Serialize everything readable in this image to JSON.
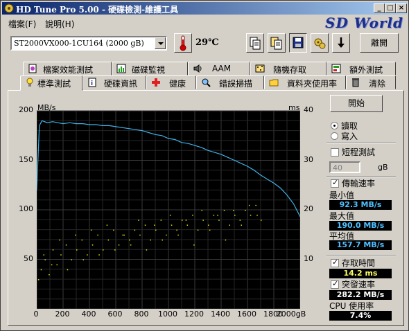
{
  "title": "HD Tune Pro  5.00 - 硬碟檢測-維護工具",
  "window_buttons": {
    "minimize": "_",
    "maximize": "□",
    "close": "×"
  },
  "menu": [
    {
      "label": "檔案(F)"
    },
    {
      "label": "說明(H)"
    }
  ],
  "brand": "SD World",
  "drive": {
    "selected": "ST2000VX000-1CU164        (2000 gB)"
  },
  "temperature": "29℃",
  "toolbar_icons": [
    "copy-icon",
    "copy-screen-icon",
    "save-icon",
    "options-icon",
    "download-icon"
  ],
  "exit_label": "離開",
  "tabs_row1": [
    {
      "label": "檔案效能測試",
      "icon": "file-benchmark-icon"
    },
    {
      "label": "磁碟監視",
      "icon": "disk-monitor-icon"
    },
    {
      "label": "AAM",
      "icon": "speaker-icon"
    },
    {
      "label": "隨機存取",
      "icon": "random-access-icon"
    },
    {
      "label": "額外測試",
      "icon": "extra-tests-icon"
    }
  ],
  "tabs_row2": [
    {
      "label": "標準測試",
      "icon": "bulb-icon",
      "active": true
    },
    {
      "label": "硬碟資訊",
      "icon": "info-icon"
    },
    {
      "label": "健康",
      "icon": "health-cross-icon"
    },
    {
      "label": "錯誤掃描",
      "icon": "magnifier-icon"
    },
    {
      "label": "資料夾使用率",
      "icon": "folder-icon"
    },
    {
      "label": "清除",
      "icon": "trash-icon"
    }
  ],
  "controls": {
    "start_label": "開始",
    "read_label": "讀取",
    "write_label": "寫入",
    "short_test_label": "短程測試",
    "short_test_value": "40",
    "short_test_unit": "gB",
    "transfer_rate_label": "傳輸速率",
    "min_label": "最小值",
    "min_value": "92.3 MB/s",
    "max_label": "最大值",
    "max_value": "190.0 MB/s",
    "avg_label": "平均值",
    "avg_value": "157.7 MB/s",
    "access_time_label": "存取時間",
    "access_time_value": "14.2 ms",
    "burst_rate_label": "突發速率",
    "burst_rate_value": "282.2 MB/s",
    "cpu_label": "CPU 使用率",
    "cpu_value": "7.4%"
  },
  "colors": {
    "transfer_line": "#3fb2e8",
    "access_points": "#e8e000",
    "chart_bg": "#000000",
    "titlebar": "#0a246a"
  },
  "chart_data": {
    "type": "line",
    "x_unit": "gB",
    "y_left_unit": "MB/s",
    "y_right_unit": "ms",
    "x_ticks": [
      "0",
      "200",
      "400",
      "600",
      "800",
      "1000",
      "1200",
      "1400",
      "1600",
      "1800",
      "2000gB"
    ],
    "y_left_ticks": [
      "50",
      "100",
      "150",
      "200"
    ],
    "y_right_ticks": [
      "10",
      "20",
      "30",
      "40"
    ],
    "xlim": [
      0,
      2000
    ],
    "ylim_left": [
      0,
      200
    ],
    "ylim_right": [
      0,
      40
    ],
    "grid": true,
    "series": [
      {
        "name": "傳輸速率",
        "axis": "left",
        "x": [
          0,
          20,
          40,
          80,
          120,
          160,
          200,
          250,
          300,
          350,
          400,
          450,
          500,
          550,
          600,
          650,
          700,
          750,
          800,
          850,
          900,
          950,
          1000,
          1050,
          1100,
          1150,
          1200,
          1250,
          1300,
          1350,
          1400,
          1450,
          1500,
          1550,
          1600,
          1650,
          1700,
          1750,
          1800,
          1850,
          1900,
          1950,
          2000
        ],
        "values": [
          120,
          185,
          190,
          188,
          189,
          188,
          187,
          188,
          187,
          187,
          186,
          186,
          185,
          185,
          184,
          183,
          182,
          181,
          180,
          178,
          176,
          175,
          172,
          171,
          168,
          167,
          165,
          163,
          160,
          158,
          156,
          153,
          150,
          147,
          144,
          140,
          135,
          131,
          127,
          122,
          115,
          106,
          93
        ]
      },
      {
        "name": "存取時間",
        "axis": "right",
        "type": "scatter",
        "x": [
          10,
          30,
          60,
          90,
          120,
          150,
          180,
          220,
          260,
          300,
          340,
          380,
          420,
          460,
          500,
          540,
          580,
          620,
          660,
          700,
          740,
          780,
          820,
          860,
          900,
          940,
          980,
          1020,
          1060,
          1100,
          1140,
          1180,
          1220,
          1260,
          1300,
          1340,
          1380,
          1420,
          1460,
          1500,
          1540,
          1580,
          1620,
          1660,
          1700,
          50,
          110,
          170,
          230,
          290,
          350,
          410,
          470,
          530,
          590,
          650,
          710,
          770,
          830,
          890,
          950,
          1010,
          1070,
          1130,
          1190,
          1250,
          1310,
          1370,
          1430,
          1490,
          1550,
          1610,
          1670
        ],
        "values": [
          6,
          8,
          10,
          7,
          12,
          9,
          11,
          13,
          10,
          12,
          14,
          11,
          13,
          15,
          12,
          14,
          16,
          13,
          15,
          14,
          16,
          15,
          17,
          14,
          16,
          18,
          15,
          17,
          16,
          18,
          17,
          19,
          16,
          18,
          17,
          19,
          18,
          20,
          17,
          19,
          18,
          20,
          19,
          21,
          18,
          11,
          9,
          14,
          8,
          15,
          10,
          16,
          11,
          17,
          12,
          15,
          13,
          18,
          12,
          17,
          14,
          19,
          15,
          18,
          13,
          20,
          16,
          19,
          14,
          20,
          17,
          21,
          19
        ]
      }
    ]
  }
}
